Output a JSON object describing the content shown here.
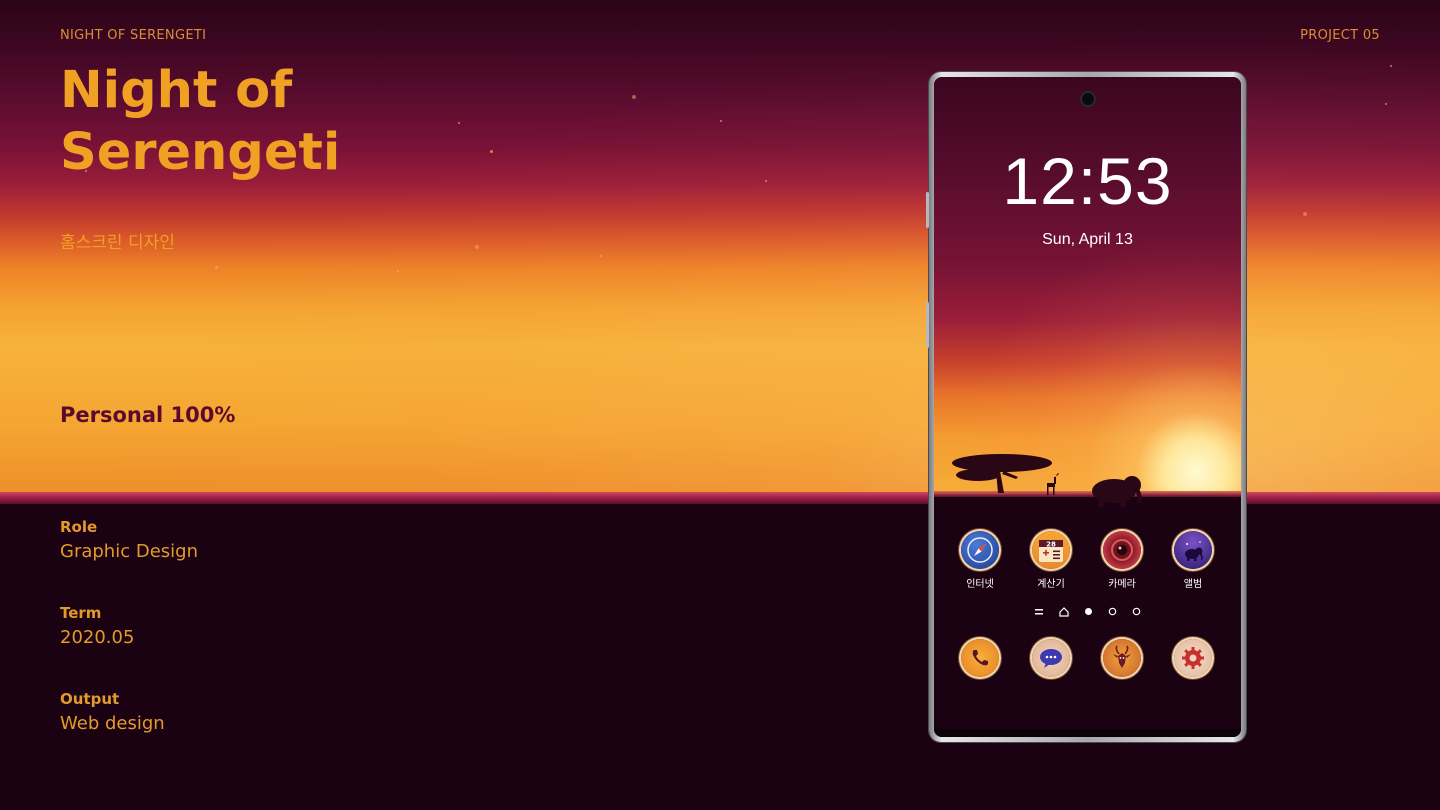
{
  "header": {
    "project_name": "NIGHT OF SERENGETI",
    "project_number": "PROJECT 05"
  },
  "hero": {
    "title_line1": "Night of",
    "title_line2": "Serengeti",
    "subtitle": "홈스크린 디자인",
    "contribution": "Personal 100%"
  },
  "info": [
    {
      "label": "Role",
      "value": "Graphic Design"
    },
    {
      "label": "Term",
      "value": "2020.05"
    },
    {
      "label": "Output",
      "value": "Web design"
    }
  ],
  "phone": {
    "time": "12:53",
    "date": "Sun, April 13",
    "apps_row1": [
      {
        "label": "인터넷",
        "icon": "compass-icon"
      },
      {
        "label": "계산기",
        "icon": "calculator-icon",
        "badge": "28"
      },
      {
        "label": "카메라",
        "icon": "camera-lens-icon"
      },
      {
        "label": "앨범",
        "icon": "elephant-album-icon"
      }
    ],
    "apps_row2": [
      {
        "icon": "phone-icon"
      },
      {
        "icon": "message-icon"
      },
      {
        "icon": "antelope-icon"
      },
      {
        "icon": "settings-gear-icon"
      }
    ],
    "pager": [
      "menu",
      "home",
      "active",
      "inactive",
      "inactive"
    ]
  },
  "colors": {
    "accent_orange": "#f0a022",
    "deep_plum": "#1b0212",
    "contribution_text": "#5b0a2e"
  }
}
